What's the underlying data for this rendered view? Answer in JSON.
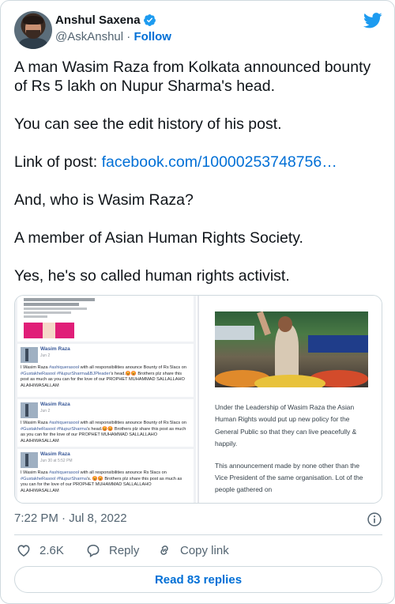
{
  "author": {
    "name": "Anshul Saxena",
    "handle": "@AskAnshul",
    "separator": "·",
    "follow_label": "Follow",
    "verified_color": "#1d9bf0"
  },
  "brand": {
    "icon": "twitter-bird-icon",
    "color": "#1d9bf0"
  },
  "tweet": {
    "paragraphs": [
      "A man Wasim Raza from Kolkata announced bounty of Rs 5 lakh on Nupur Sharma's head.",
      "You can see the edit history of his post.",
      "And, who is Wasim Raza?",
      "A member of Asian Human Rights Society.",
      "Yes, he's so called human rights activist."
    ],
    "link_prefix": "Link of post: ",
    "link_text": "facebook.com/10000253748756…"
  },
  "media": {
    "posts": [
      {
        "name": "Wasim Raza",
        "date": "Jun 2",
        "text_a": "I Wasim Raza ",
        "tag_a": "#ashiquerasool",
        "text_b": " with all responsibilities anounce Bounty of Rs 5lacs on ",
        "tag_b": "#GustakheRasool #NupurSharma&BJPleader",
        "text_c": "'s head.😡😡 Brothers plz share this post as much as you can for the love of our PROPHET MUHAMMAD SALLALLAHO ALAIHIWASALLAM"
      },
      {
        "name": "Wasim Raza",
        "date": "Jun 2",
        "text_a": "I Wasim Raza ",
        "tag_a": "#ashiquerasool",
        "text_b": " with all responsibilities anounce Bounty of Rs 5lacs on ",
        "tag_b": "#GustakheRasool #NupurSharma",
        "text_c": "'s head.😡😡 Brothers plz share this post as much as you can for the love of our PROPHET MUHAMMAD SALLALLAHO ALAIHIWASALLAM"
      },
      {
        "name": "Wasim Raza",
        "date": "Jun 30 at 5:52 PM",
        "text_a": "I Wasim Raza ",
        "tag_a": "#ashiquerasool",
        "text_b": " with all responsibilities anounce Rs 5lacs on ",
        "tag_b": "#GustakheRasool #NupurSharma",
        "text_c": "'s. 😡😡 Brothers plz share this post as much as you can for the love of our PROPHET MUHAMMAD SALLALLAHO ALAIHIWASALLAM"
      }
    ],
    "article_paragraphs": [
      "Under the Leadership of Wasim Raza the Asian Human Rights would put up new policy for the General Public so that they can live peacefully & happily.",
      "This announcement made by none other than the Vice President of the same organisation. Lot of the people gathered on"
    ]
  },
  "meta": {
    "timestamp": "7:22 PM · Jul 8, 2022",
    "info_icon": "info-icon"
  },
  "actions": {
    "like_count": "2.6K",
    "reply_label": "Reply",
    "copy_label": "Copy link",
    "like_color": "#536471"
  },
  "replies_button": {
    "label": "Read 83 replies"
  },
  "colors": {
    "link": "#006fd6",
    "text": "#0f1419",
    "muted": "#536471",
    "border": "#cfd9de"
  }
}
